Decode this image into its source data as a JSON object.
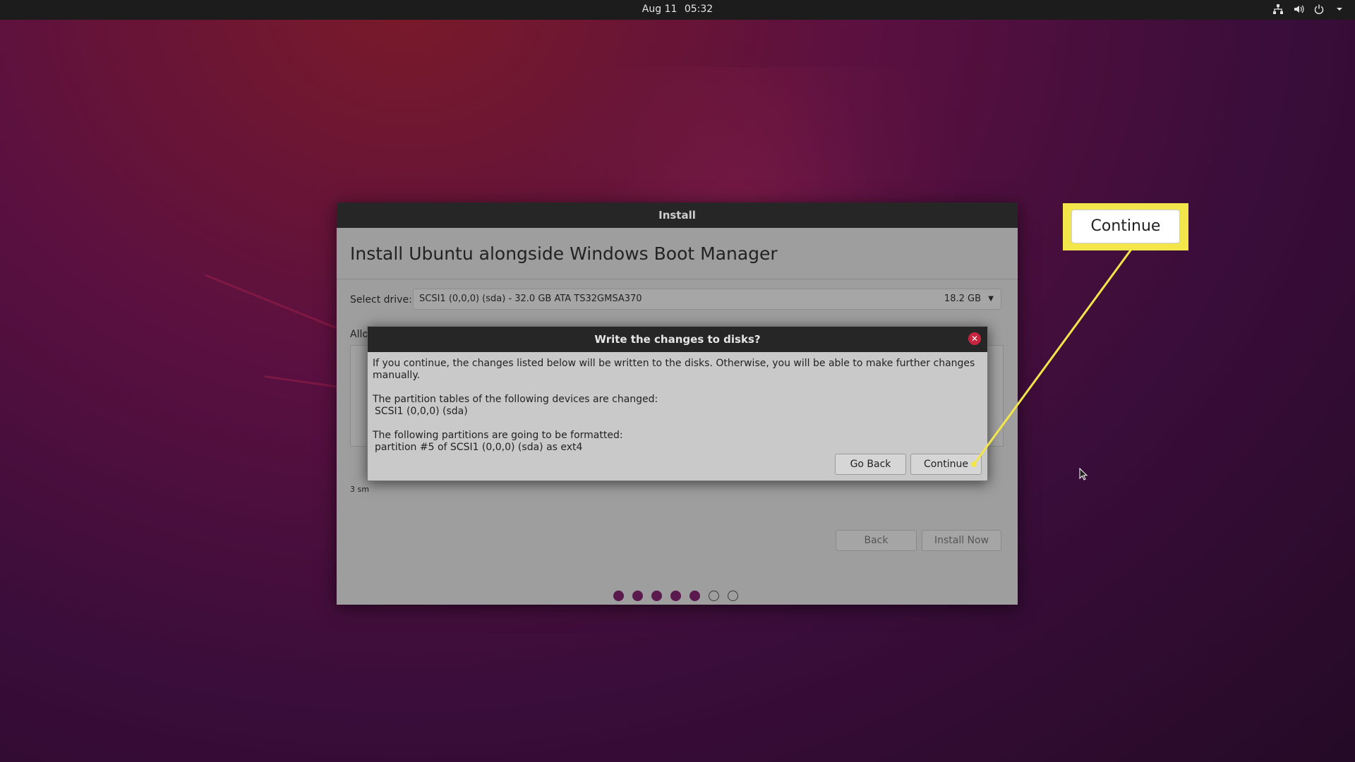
{
  "topbar": {
    "date": "Aug 11",
    "time": "05:32",
    "tray_icons": [
      "network-icon",
      "volume-icon",
      "power-icon",
      "chevron-down-icon"
    ]
  },
  "installer": {
    "window_title": "Install",
    "heading": "Install Ubuntu alongside Windows Boot Manager",
    "select_drive_label": "Select drive:",
    "drive_value": "SCSI1 (0,0,0) (sda) - 32.0 GB ATA TS32GMSA370",
    "drive_size": "18.2 GB",
    "allocate_label_partial": "Allo",
    "note_partial": "3 sm",
    "back_label": "Back",
    "install_now_label": "Install Now",
    "progress_steps_total": 7,
    "progress_steps_done": 5
  },
  "dialog": {
    "title": "Write the changes to disks?",
    "intro": "If you continue, the changes listed below will be written to the disks. Otherwise, you will be able to make further changes manually.",
    "partition_tables_heading": "The partition tables of the following devices are changed:",
    "partition_tables_device": "SCSI1 (0,0,0) (sda)",
    "format_heading": "The following partitions are going to be formatted:",
    "format_item": "partition #5 of SCSI1 (0,0,0) (sda) as ext4",
    "go_back_label": "Go Back",
    "continue_label": "Continue"
  },
  "callout": {
    "label": "Continue",
    "highlight_color": "#f2e64a"
  }
}
